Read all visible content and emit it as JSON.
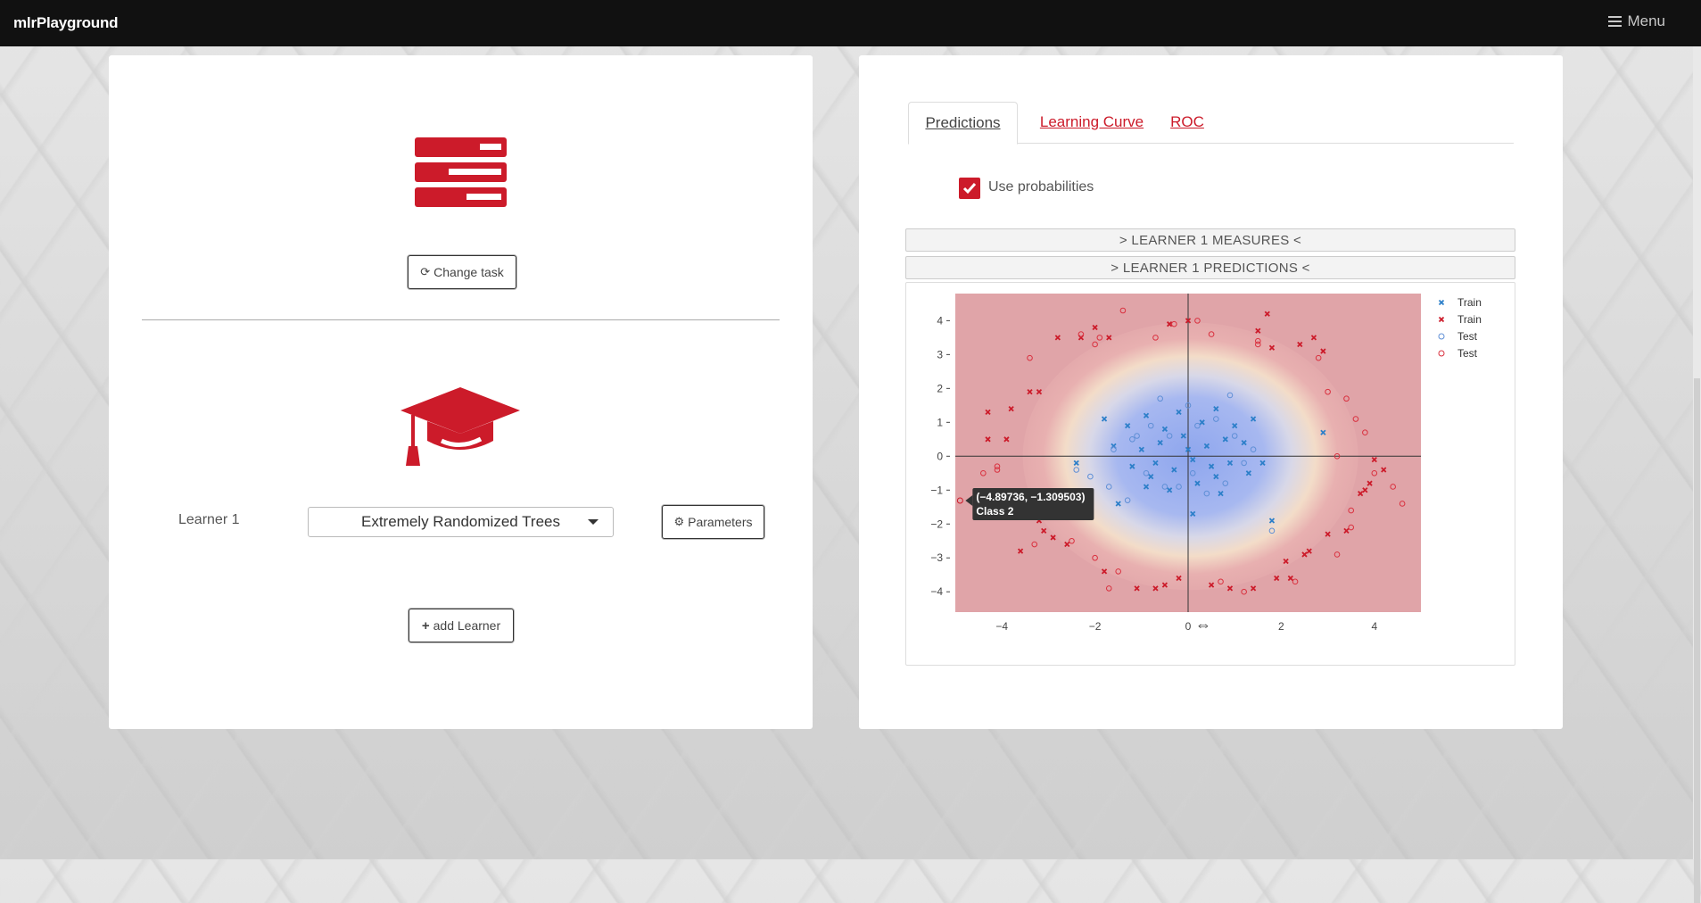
{
  "app": {
    "title": "mlrPlayground",
    "menu_label": "Menu"
  },
  "left_panel": {
    "change_task_label": "Change task",
    "learner_label": "Learner 1",
    "learner_select_value": "Extremely Randomized Trees",
    "parameters_label": "Parameters",
    "add_learner_label": "add Learner"
  },
  "right_panel": {
    "tabs": [
      {
        "label": "Predictions",
        "active": true
      },
      {
        "label": "Learning Curve",
        "active": false
      },
      {
        "label": "ROC",
        "active": false
      }
    ],
    "use_probabilities_label": "Use probabilities",
    "use_probabilities_checked": true,
    "measures_bar": "> LEARNER 1 MEASURES <",
    "predictions_bar": "> LEARNER 1 PREDICTIONS <"
  },
  "colors": {
    "accent": "#cc1b2a",
    "train_class1": "#2c7fc9",
    "train_class2": "#cc1b2a",
    "test_class1": "#5f8fd6",
    "test_class2": "#d9313f"
  },
  "chart_data": {
    "type": "scatter",
    "title": "",
    "xlabel": "",
    "ylabel": "",
    "xlim": [
      -5,
      5
    ],
    "ylim": [
      -4.6,
      4.8
    ],
    "x_ticks": [
      "−4",
      "−2",
      "0",
      "2",
      "4"
    ],
    "y_ticks": [
      "4",
      "3",
      "2",
      "1",
      "0",
      "−1",
      "−2",
      "−3",
      "−4"
    ],
    "legend": [
      "Train",
      "Train",
      "Test",
      "Test"
    ],
    "legend_position": "top-right",
    "tooltip": {
      "coords": "(−4.89736, −1.309503)",
      "label": "Class 2",
      "x": -4.89736,
      "y": -1.309503
    },
    "series": [
      {
        "name": "Train",
        "marker": "x",
        "points": [
          [
            -1.8,
            1.1
          ],
          [
            -1.3,
            0.9
          ],
          [
            -0.9,
            1.2
          ],
          [
            -0.5,
            0.8
          ],
          [
            -0.2,
            1.3
          ],
          [
            0.3,
            1.0
          ],
          [
            0.6,
            1.4
          ],
          [
            1.0,
            0.9
          ],
          [
            1.4,
            1.1
          ],
          [
            -1.6,
            0.3
          ],
          [
            -1.0,
            0.2
          ],
          [
            -0.6,
            0.4
          ],
          [
            -0.1,
            0.6
          ],
          [
            0.4,
            0.3
          ],
          [
            0.8,
            0.5
          ],
          [
            1.2,
            0.4
          ],
          [
            -1.2,
            -0.3
          ],
          [
            -0.7,
            -0.2
          ],
          [
            -0.3,
            -0.4
          ],
          [
            0.1,
            -0.1
          ],
          [
            0.5,
            -0.3
          ],
          [
            0.9,
            -0.2
          ],
          [
            1.3,
            -0.5
          ],
          [
            -0.9,
            -0.9
          ],
          [
            -0.4,
            -1.0
          ],
          [
            0.2,
            -0.8
          ],
          [
            0.7,
            -1.1
          ],
          [
            -1.5,
            -1.4
          ],
          [
            0.1,
            -1.7
          ],
          [
            1.8,
            -1.9
          ],
          [
            2.9,
            0.7
          ],
          [
            -2.4,
            -0.2
          ],
          [
            1.6,
            -0.2
          ],
          [
            -0.8,
            -0.6
          ],
          [
            0.0,
            0.2
          ],
          [
            0.6,
            -0.6
          ]
        ]
      },
      {
        "name": "Train",
        "marker": "x",
        "points": [
          [
            -4.3,
            1.3
          ],
          [
            -3.8,
            1.4
          ],
          [
            -3.2,
            1.9
          ],
          [
            -4.3,
            0.5
          ],
          [
            -3.9,
            0.5
          ],
          [
            -3.2,
            -1.9
          ],
          [
            -2.9,
            -2.4
          ],
          [
            -3.6,
            -2.8
          ],
          [
            -3.1,
            -2.2
          ],
          [
            -2.6,
            -2.6
          ],
          [
            -1.8,
            -3.4
          ],
          [
            -1.1,
            -3.9
          ],
          [
            -0.7,
            -3.9
          ],
          [
            -0.5,
            -3.8
          ],
          [
            -0.2,
            -3.6
          ],
          [
            0.5,
            -3.8
          ],
          [
            0.9,
            -3.9
          ],
          [
            1.4,
            -3.9
          ],
          [
            1.9,
            -3.6
          ],
          [
            2.2,
            -3.6
          ],
          [
            2.1,
            -3.1
          ],
          [
            2.5,
            -2.9
          ],
          [
            2.6,
            -2.8
          ],
          [
            3.0,
            -2.3
          ],
          [
            3.4,
            -2.2
          ],
          [
            3.7,
            -1.1
          ],
          [
            3.9,
            -0.8
          ],
          [
            4.0,
            -0.1
          ],
          [
            4.2,
            -0.4
          ],
          [
            2.7,
            3.5
          ],
          [
            2.4,
            3.3
          ],
          [
            1.8,
            3.2
          ],
          [
            1.5,
            3.7
          ],
          [
            0.0,
            4.0
          ],
          [
            -0.4,
            3.9
          ],
          [
            -1.7,
            3.5
          ],
          [
            -2.0,
            3.8
          ],
          [
            -2.3,
            3.5
          ],
          [
            -2.8,
            3.5
          ],
          [
            -3.4,
            1.9
          ],
          [
            -4.3,
            -1.3
          ],
          [
            3.8,
            -1.0
          ],
          [
            2.9,
            3.1
          ],
          [
            1.7,
            4.2
          ]
        ]
      },
      {
        "name": "Test",
        "marker": "o",
        "points": [
          [
            -1.6,
            0.2
          ],
          [
            -1.2,
            0.5
          ],
          [
            -0.8,
            0.9
          ],
          [
            -0.4,
            0.6
          ],
          [
            0.2,
            0.9
          ],
          [
            0.6,
            1.1
          ],
          [
            1.0,
            0.6
          ],
          [
            1.4,
            0.2
          ],
          [
            -1.7,
            -0.9
          ],
          [
            -1.3,
            -1.3
          ],
          [
            -0.9,
            -0.5
          ],
          [
            -0.5,
            -0.9
          ],
          [
            0.1,
            -0.5
          ],
          [
            0.4,
            -1.1
          ],
          [
            0.8,
            -0.8
          ],
          [
            1.2,
            -0.2
          ],
          [
            -0.6,
            1.7
          ],
          [
            0.0,
            1.5
          ],
          [
            0.9,
            1.8
          ],
          [
            -2.1,
            -0.6
          ],
          [
            -2.4,
            -0.4
          ],
          [
            1.8,
            -2.2
          ],
          [
            -0.2,
            -0.9
          ],
          [
            -1.1,
            0.6
          ]
        ]
      },
      {
        "name": "Test",
        "marker": "o",
        "points": [
          [
            -4.4,
            -0.5
          ],
          [
            -4.1,
            -0.4
          ],
          [
            -3.4,
            2.9
          ],
          [
            -2.3,
            3.6
          ],
          [
            -1.9,
            3.5
          ],
          [
            -1.4,
            4.3
          ],
          [
            -0.7,
            3.5
          ],
          [
            -0.3,
            3.9
          ],
          [
            0.2,
            4.0
          ],
          [
            0.5,
            3.6
          ],
          [
            1.5,
            3.3
          ],
          [
            2.8,
            2.9
          ],
          [
            3.0,
            1.9
          ],
          [
            3.4,
            1.7
          ],
          [
            3.6,
            1.1
          ],
          [
            3.8,
            0.7
          ],
          [
            4.0,
            -0.5
          ],
          [
            4.4,
            -0.9
          ],
          [
            4.6,
            -1.4
          ],
          [
            3.2,
            -2.9
          ],
          [
            3.5,
            -2.1
          ],
          [
            2.3,
            -3.7
          ],
          [
            1.2,
            -4.0
          ],
          [
            0.7,
            -3.7
          ],
          [
            -1.5,
            -3.4
          ],
          [
            -2.0,
            -3.0
          ],
          [
            -2.5,
            -2.5
          ],
          [
            -3.3,
            -2.6
          ],
          [
            -4.1,
            -0.3
          ],
          [
            -1.7,
            -3.9
          ],
          [
            3.2,
            0.0
          ],
          [
            3.5,
            -1.6
          ],
          [
            -2.0,
            3.3
          ],
          [
            1.5,
            3.4
          ]
        ]
      }
    ]
  }
}
